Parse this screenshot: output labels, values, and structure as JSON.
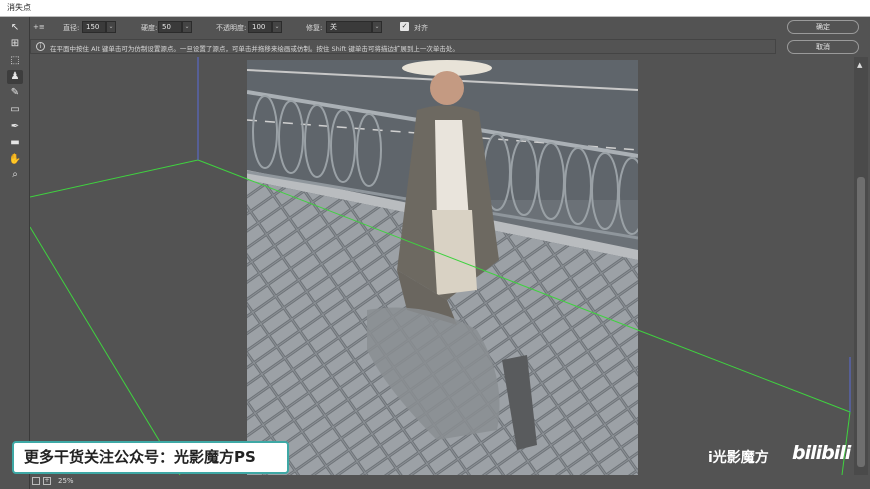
{
  "window": {
    "title": "消失点"
  },
  "toolbar": {
    "tools": [
      {
        "name": "edit-plane-tool",
        "glyph": "↖"
      },
      {
        "name": "create-plane-tool",
        "glyph": "⊞"
      },
      {
        "name": "marquee-tool",
        "glyph": "⬚"
      },
      {
        "name": "stamp-tool",
        "glyph": "♟"
      },
      {
        "name": "brush-tool",
        "glyph": "✎"
      },
      {
        "name": "transform-tool",
        "glyph": "▭"
      },
      {
        "name": "eyedropper-tool",
        "glyph": "✒"
      },
      {
        "name": "measure-tool",
        "glyph": "▬"
      },
      {
        "name": "hand-tool",
        "glyph": "✋"
      },
      {
        "name": "zoom-tool",
        "glyph": "⌕"
      }
    ]
  },
  "options": {
    "mode_glyph": "+≡",
    "diameter_label": "直径:",
    "diameter_value": "150",
    "hardness_label": "硬度:",
    "hardness_value": "50",
    "opacity_label": "不透明度:",
    "opacity_value": "100",
    "heal_label": "修复:",
    "heal_value": "关",
    "align_label": "对齐",
    "align_checked": true
  },
  "info": {
    "text": "在平面中按住 Alt 键单击可为仿制设置源点。一旦设置了源点，可单击并拖移来绘画或仿制。按住 Shift 键单击可将描边扩展到上一次单击处。"
  },
  "buttons": {
    "ok": "确定",
    "cancel": "取消"
  },
  "status": {
    "zoom": "25%"
  },
  "overlay": {
    "watermark": "更多干货关注公众号：光影魔方PS",
    "brand": "i光影魔方",
    "bili": "bilibili"
  },
  "colors": {
    "grid_line": "#3fd23f",
    "grid_blue": "#5a6bd8",
    "panel_bg": "#535353",
    "accent": "#3ea8a5"
  }
}
